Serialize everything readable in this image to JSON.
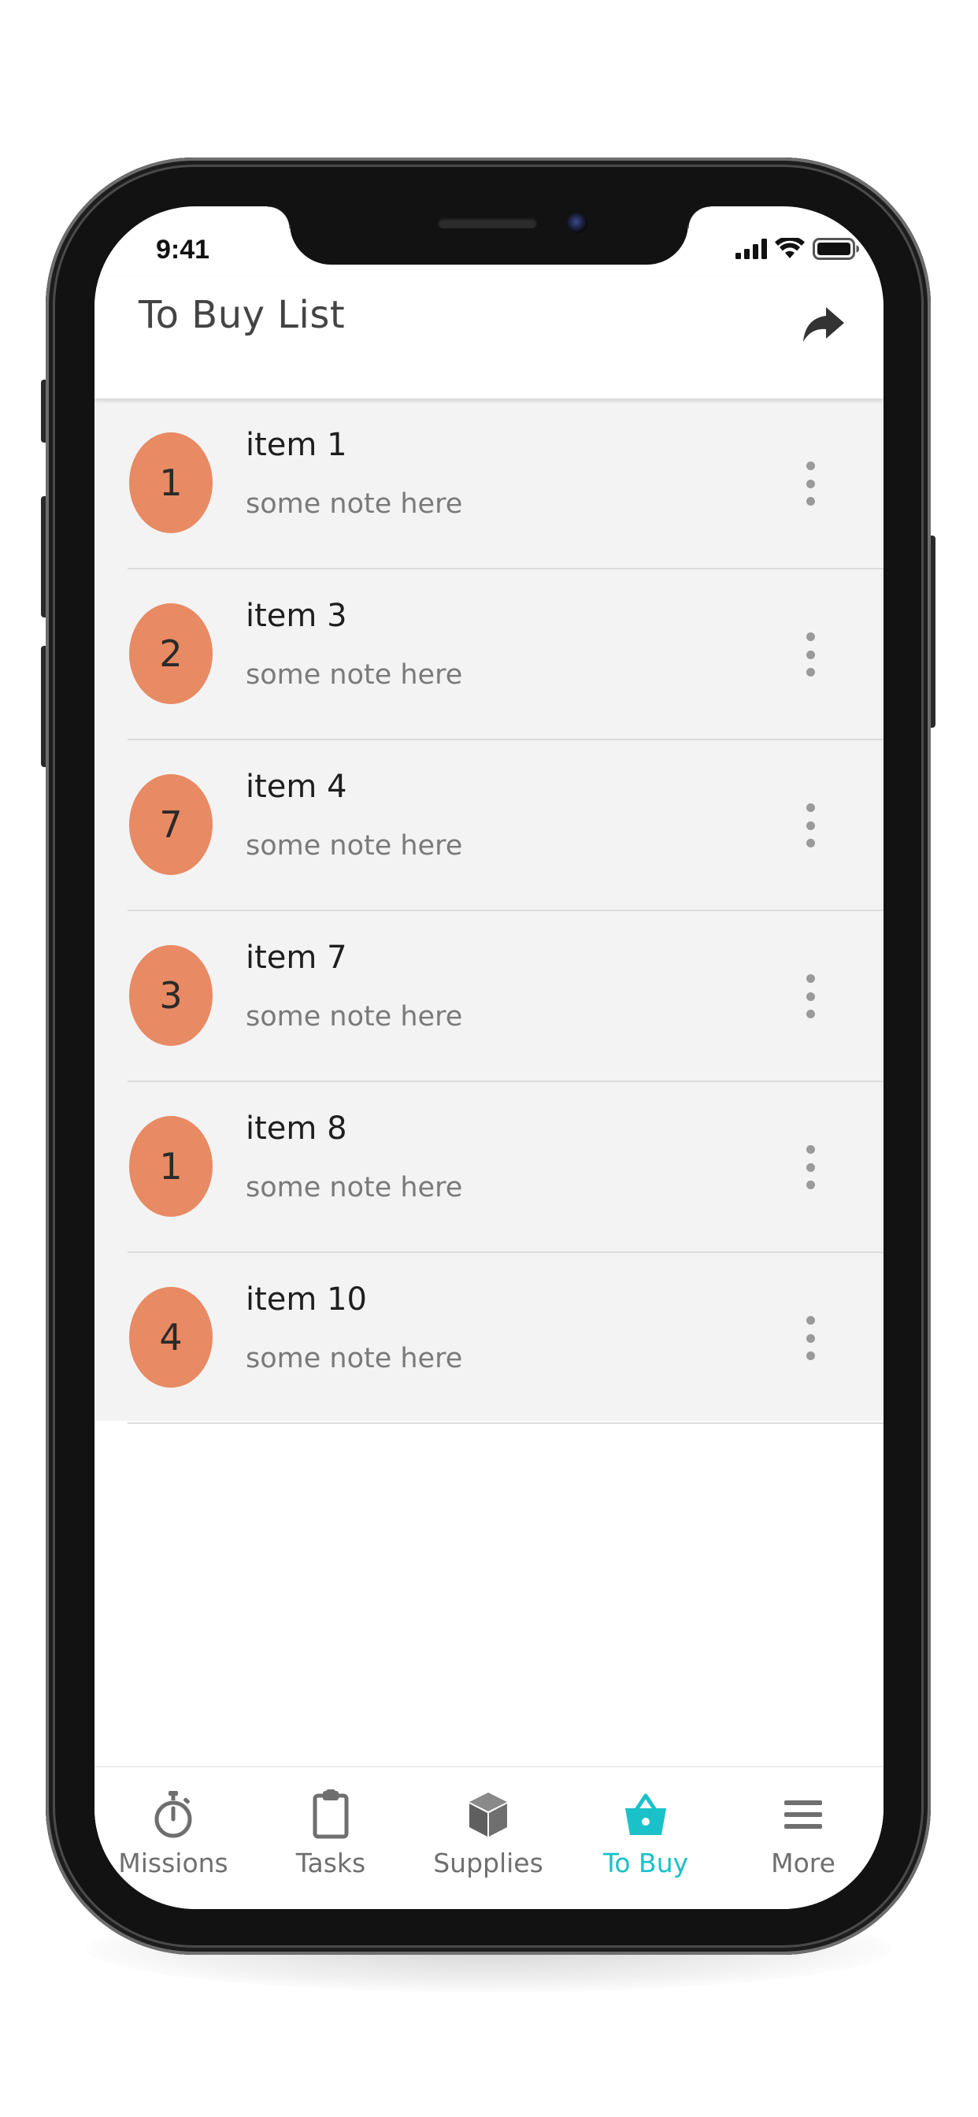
{
  "status_bar": {
    "time": "9:41"
  },
  "header": {
    "title": "To Buy List",
    "share_icon": "share-forward-icon"
  },
  "colors": {
    "badge": "#e88a63",
    "active_tab": "#1bc1c9",
    "inactive_tab": "#6f6f6f",
    "list_background": "#f3f3f3"
  },
  "items": [
    {
      "count": "1",
      "name": "item 1",
      "note": "some note here"
    },
    {
      "count": "2",
      "name": "item 3",
      "note": "some note here"
    },
    {
      "count": "7",
      "name": "item 4",
      "note": "some note here"
    },
    {
      "count": "3",
      "name": "item 7",
      "note": "some note here"
    },
    {
      "count": "1",
      "name": "item 8",
      "note": "some note here"
    },
    {
      "count": "4",
      "name": "item 10",
      "note": "some note here"
    }
  ],
  "tabs": [
    {
      "label": "Missions",
      "icon": "stopwatch-icon",
      "active": false
    },
    {
      "label": "Tasks",
      "icon": "clipboard-icon",
      "active": false
    },
    {
      "label": "Supplies",
      "icon": "box-icon",
      "active": false
    },
    {
      "label": "To Buy",
      "icon": "basket-icon",
      "active": true
    },
    {
      "label": "More",
      "icon": "menu-icon",
      "active": false
    }
  ]
}
